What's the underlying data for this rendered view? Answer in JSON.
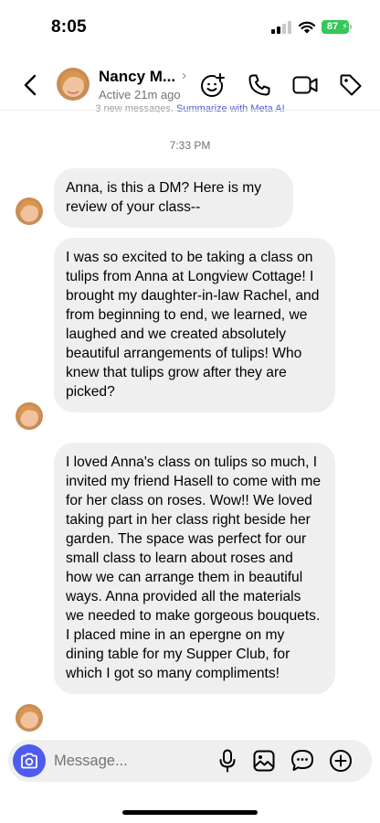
{
  "status_bar": {
    "time": "8:05",
    "battery": "87"
  },
  "header": {
    "contact_name": "Nancy M...",
    "contact_status": "Active 21m ago",
    "back_icon": "chevron-left-icon",
    "actions": [
      "add-effect-icon",
      "phone-icon",
      "video-icon",
      "tag-icon"
    ]
  },
  "banner": {
    "text": "3 new messages.",
    "link": "Summarize with Meta AI"
  },
  "conversation": {
    "timestamp": "7:33 PM",
    "messages": [
      {
        "text": "Anna, is this a DM? Here is my review of your class--"
      },
      {
        "text": "I was so excited to be taking a class on tulips from Anna at Longview Cottage! I brought my daughter-in-law Rachel, and from beginning to end, we learned, we laughed and we created absolutely beautiful arrangements of tulips! Who knew that tulips grow after they are picked?"
      },
      {
        "text": "I loved Anna's class on tulips so much, I invited my friend Hasell to come with me for her class on roses. Wow!! We loved taking part in her class right beside her garden. The space was perfect for our small class to learn about roses and how we can arrange them in beautiful ways. Anna provided all the materials we needed to make gorgeous bouquets. I placed mine in an epergne on my dining table for my Supper Club, for which I got so many compliments!"
      }
    ]
  },
  "composer": {
    "placeholder": "Message...",
    "icons": [
      "camera-icon",
      "microphone-icon",
      "gallery-icon",
      "sticker-icon",
      "plus-icon"
    ]
  },
  "colors": {
    "accent": "#4e5bf0",
    "bubble": "#efefef",
    "battery": "#34c759"
  }
}
